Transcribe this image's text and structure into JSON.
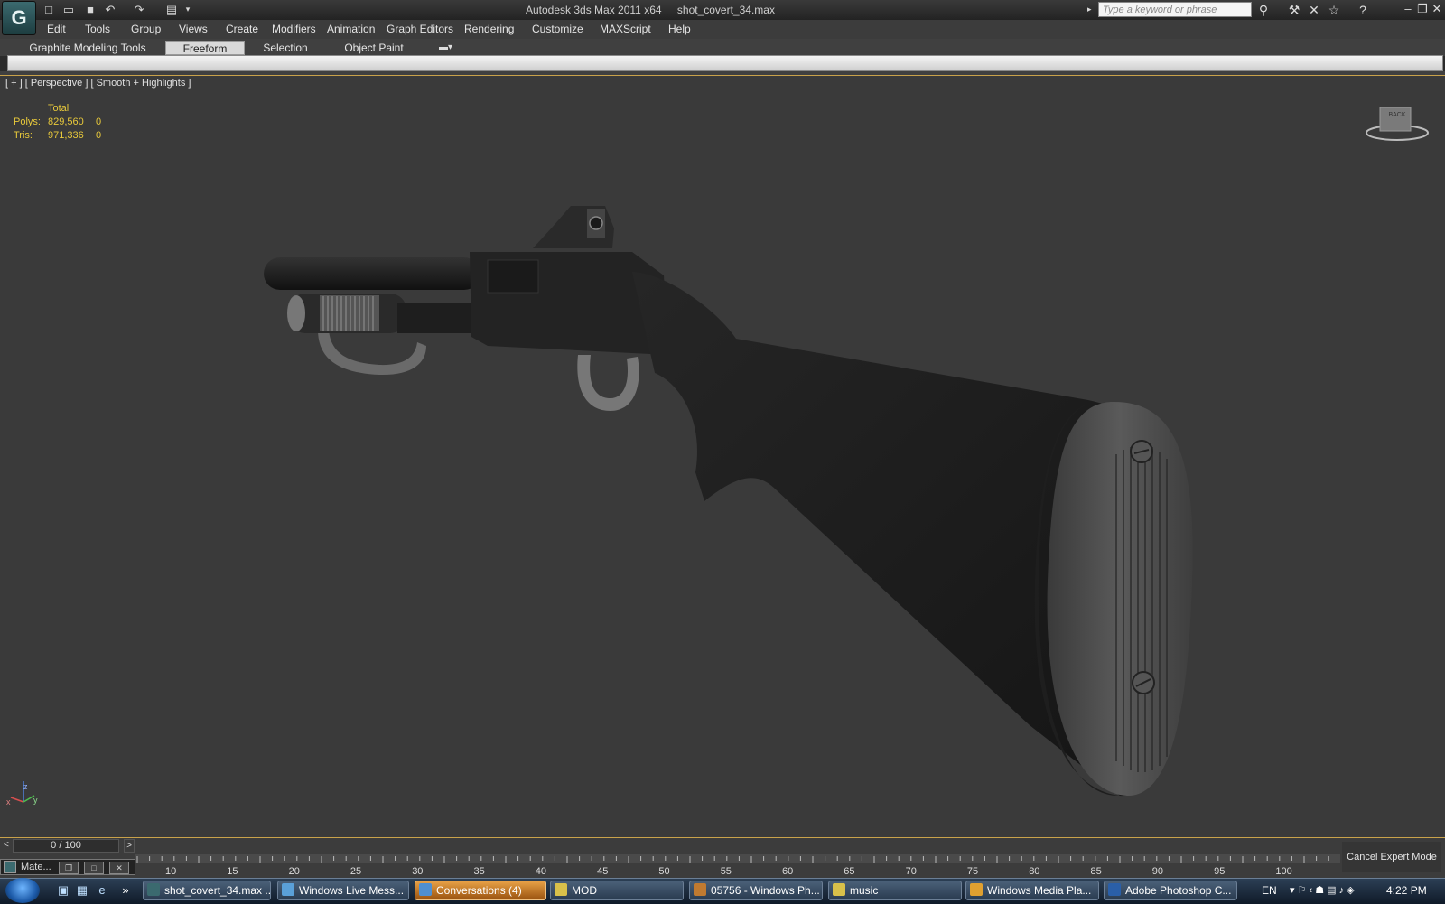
{
  "titlebar": {
    "app_name": "Autodesk 3ds Max  2011 x64",
    "file_name": "shot_covert_34.max",
    "search_placeholder": "Type a keyword or phrase"
  },
  "menu": [
    "Edit",
    "Tools",
    "Group",
    "Views",
    "Create",
    "Modifiers",
    "Animation",
    "Graph Editors",
    "Rendering",
    "Customize",
    "MAXScript",
    "Help"
  ],
  "ribbon": {
    "tabs": [
      "Graphite Modeling Tools",
      "Freeform",
      "Selection",
      "Object Paint"
    ],
    "active_tab": "Freeform"
  },
  "viewport": {
    "label": "[ + ] [ Perspective ] [ Smooth + Highlights ]",
    "stats": {
      "header": "Total",
      "rows": [
        {
          "label": "Polys:",
          "total": "829,560",
          "selected": "0"
        },
        {
          "label": "Tris:",
          "total": "971,336",
          "selected": "0"
        }
      ]
    },
    "viewcube_label": "BACK",
    "gizmo_axes": {
      "z": "z",
      "y": "y",
      "x": "x"
    }
  },
  "timeline": {
    "value": "0 / 100",
    "ticks": [
      "10",
      "15",
      "20",
      "25",
      "30",
      "35",
      "40",
      "45",
      "50",
      "55",
      "60",
      "65",
      "70",
      "75",
      "80",
      "85",
      "90",
      "95",
      "100"
    ],
    "cancel_expert": "Cancel Expert Mode",
    "mat_label": "Mate..."
  },
  "taskbar": {
    "items": [
      {
        "label": "shot_covert_34.max ...",
        "color": "#3b6a6f",
        "highlight": false
      },
      {
        "label": "Windows Live Mess...",
        "color": "#5aa0d8",
        "highlight": false
      },
      {
        "label": "Conversations (4)",
        "color": "#4f8fd0",
        "highlight": true
      },
      {
        "label": "MOD",
        "color": "#d8c04a",
        "highlight": false
      },
      {
        "label": "05756 - Windows Ph...",
        "color": "#c07a30",
        "highlight": false
      },
      {
        "label": "music",
        "color": "#d8c04a",
        "highlight": false
      },
      {
        "label": "Windows Media Pla...",
        "color": "#e0a030",
        "highlight": false
      },
      {
        "label": "Adobe Photoshop C...",
        "color": "#2a5fa8",
        "highlight": false
      }
    ],
    "lang": "EN",
    "clock": "4:22 PM"
  },
  "colors": {
    "viewport_bg": "#3a3a3a",
    "stats": "#e8c93b",
    "active_border": "#c9a24a"
  }
}
